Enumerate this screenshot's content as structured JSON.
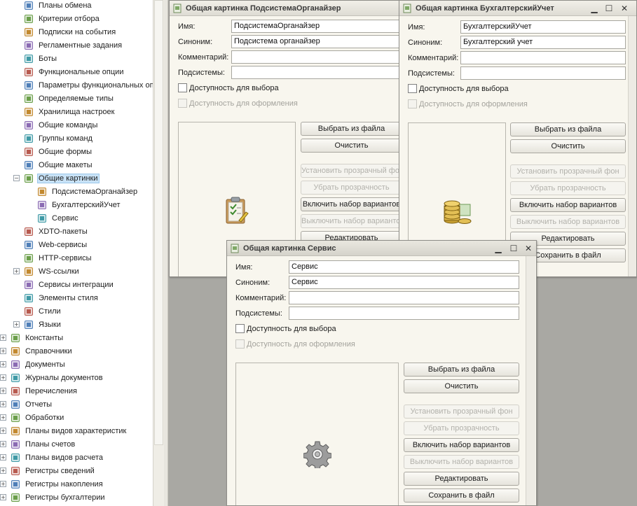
{
  "tree": {
    "items": [
      {
        "label": "Планы обмена",
        "icon": "exchange-plans-icon",
        "level": 1
      },
      {
        "label": "Критерии отбора",
        "icon": "filter-criteria-icon",
        "level": 1
      },
      {
        "label": "Подписки на события",
        "icon": "event-subscriptions-icon",
        "level": 1
      },
      {
        "label": "Регламентные задания",
        "icon": "scheduled-jobs-icon",
        "level": 1
      },
      {
        "label": "Боты",
        "icon": "bots-icon",
        "level": 1
      },
      {
        "label": "Функциональные опции",
        "icon": "functional-options-icon",
        "level": 1
      },
      {
        "label": "Параметры функциональных оп",
        "icon": "functional-params-icon",
        "level": 1
      },
      {
        "label": "Определяемые типы",
        "icon": "defined-types-icon",
        "level": 1
      },
      {
        "label": "Хранилища настроек",
        "icon": "settings-storage-icon",
        "level": 1
      },
      {
        "label": "Общие команды",
        "icon": "common-commands-icon",
        "level": 1
      },
      {
        "label": "Группы команд",
        "icon": "command-groups-icon",
        "level": 1
      },
      {
        "label": "Общие формы",
        "icon": "common-forms-icon",
        "level": 1
      },
      {
        "label": "Общие макеты",
        "icon": "common-templates-icon",
        "level": 1
      },
      {
        "label": "Общие картинки",
        "icon": "common-pictures-icon",
        "level": 1,
        "selected": true,
        "expanded": true
      },
      {
        "label": "ПодсистемаОрганайзер",
        "icon": "picture-item-icon",
        "level": 2
      },
      {
        "label": "БухгалтерскийУчет",
        "icon": "picture-item-icon",
        "level": 2
      },
      {
        "label": "Сервис",
        "icon": "picture-item-icon",
        "level": 2
      },
      {
        "label": "XDTO-пакеты",
        "icon": "xdto-packages-icon",
        "level": 1
      },
      {
        "label": "Web-сервисы",
        "icon": "web-services-icon",
        "level": 1
      },
      {
        "label": "HTTP-сервисы",
        "icon": "http-services-icon",
        "level": 1
      },
      {
        "label": "WS-ссылки",
        "icon": "ws-references-icon",
        "level": 1,
        "collapsed": true
      },
      {
        "label": "Сервисы интеграции",
        "icon": "integration-services-icon",
        "level": 1
      },
      {
        "label": "Элементы стиля",
        "icon": "style-items-icon",
        "level": 1
      },
      {
        "label": "Стили",
        "icon": "styles-icon",
        "level": 1
      },
      {
        "label": "Языки",
        "icon": "languages-icon",
        "level": 1,
        "collapsed": true
      },
      {
        "label": "Константы",
        "icon": "constants-icon",
        "level": 0
      },
      {
        "label": "Справочники",
        "icon": "catalogs-icon",
        "level": 0
      },
      {
        "label": "Документы",
        "icon": "documents-icon",
        "level": 0
      },
      {
        "label": "Журналы документов",
        "icon": "document-journals-icon",
        "level": 0
      },
      {
        "label": "Перечисления",
        "icon": "enumerations-icon",
        "level": 0
      },
      {
        "label": "Отчеты",
        "icon": "reports-icon",
        "level": 0
      },
      {
        "label": "Обработки",
        "icon": "data-processors-icon",
        "level": 0
      },
      {
        "label": "Планы видов характеристик",
        "icon": "characteristic-types-icon",
        "level": 0
      },
      {
        "label": "Планы счетов",
        "icon": "charts-of-accounts-icon",
        "level": 0
      },
      {
        "label": "Планы видов расчета",
        "icon": "calculation-types-icon",
        "level": 0
      },
      {
        "label": "Регистры сведений",
        "icon": "information-registers-icon",
        "level": 0
      },
      {
        "label": "Регистры накопления",
        "icon": "accumulation-registers-icon",
        "level": 0
      },
      {
        "label": "Регистры бухгалтерии",
        "icon": "accounting-registers-icon",
        "level": 0
      }
    ]
  },
  "form_labels": {
    "name": "Имя:",
    "synonym": "Синоним:",
    "comment": "Комментарий:",
    "subsystems": "Подсистемы:",
    "available_for_choice": "Доступность для выбора",
    "available_for_design": "Доступность для оформления",
    "dots": "..."
  },
  "buttons": {
    "choose_from_file": "Выбрать из файла",
    "clear": "Очистить",
    "set_transparent": "Установить прозрачный фон",
    "remove_transparency": "Убрать прозрачность",
    "enable_variants": "Включить набор вариантов",
    "disable_variants": "Выключить набор вариантов",
    "edit": "Редактировать",
    "save_to_file": "Сохранить в файл"
  },
  "windows": {
    "organizer": {
      "title": "Общая картинка ПодсистемаОрганайзер",
      "name_value": "ПодсистемаОрганайзер",
      "synonym_value": "Подсистема органайзер",
      "comment_value": "",
      "subsystems_value": "",
      "picture_icon": "clipboard-checklist-icon"
    },
    "accounting": {
      "title": "Общая картинка БухгалтерскийУчет",
      "name_value": "БухгалтерскийУчет",
      "synonym_value": "Бухгалтерский учет",
      "comment_value": "",
      "subsystems_value": "",
      "picture_icon": "coins-stack-icon"
    },
    "service": {
      "title": "Общая картинка Сервис",
      "name_value": "Сервис",
      "synonym_value": "Сервис",
      "comment_value": "",
      "subsystems_value": "",
      "picture_icon": "gear-icon"
    }
  },
  "colors": {
    "selection": "#c9e3f7",
    "window_bg": "#f8f6ee",
    "workspace_bg": "#a9a8a3"
  }
}
